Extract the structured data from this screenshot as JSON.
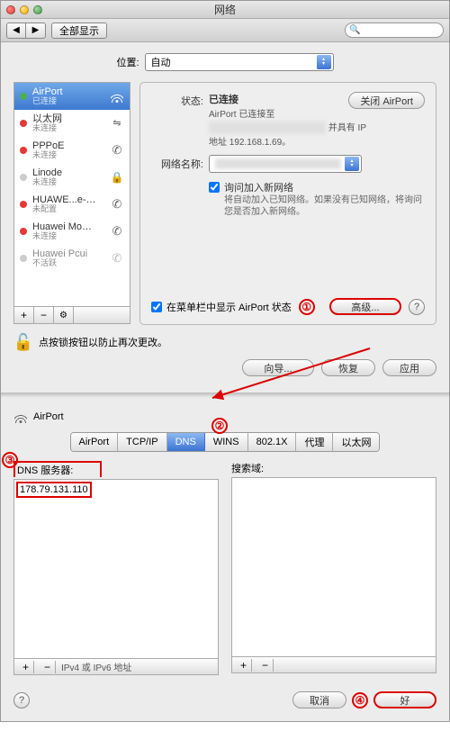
{
  "window": {
    "title": "网络"
  },
  "toolbar": {
    "showall": "全部显示"
  },
  "location": {
    "label": "位置:",
    "value": "自动"
  },
  "sidebar": {
    "items": [
      {
        "name": "AirPort",
        "status": "已连接",
        "dot": "green",
        "icon": "wifi"
      },
      {
        "name": "以太网",
        "status": "未连接",
        "dot": "red",
        "icon": "ethernet"
      },
      {
        "name": "PPPoE",
        "status": "未连接",
        "dot": "red",
        "icon": "phone"
      },
      {
        "name": "Linode",
        "status": "未连接",
        "dot": "none",
        "icon": "lock"
      },
      {
        "name": "HUAWE...e-MMS",
        "status": "未配置",
        "dot": "red",
        "icon": "phone"
      },
      {
        "name": "Huawei Modem",
        "status": "未连接",
        "dot": "red",
        "icon": "phone"
      },
      {
        "name": "Huawei Pcui",
        "status": "不活跃",
        "dot": "none",
        "icon": "phone"
      }
    ]
  },
  "pane": {
    "status_k": "状态:",
    "status_v": "已连接",
    "close_airport": "关闭 AirPort",
    "status_detail1": "AirPort 已连接至",
    "status_detail2": "并具有 IP",
    "status_detail3": "地址 192.168.1.69。",
    "netname_k": "网络名称:",
    "ask_join": "询问加入新网络",
    "ask_hint": "将自动加入已知网络。如果没有已知网络，将询问您是否加入新网络。",
    "showmenu": "在菜单栏中显示 AirPort 状态",
    "advanced": "高级..."
  },
  "lockrow": {
    "text": "点按锁按钮以防止再次更改。"
  },
  "actions": {
    "wizard": "向导...",
    "revert": "恢复",
    "apply": "应用"
  },
  "panel2": {
    "title": "AirPort",
    "tabs": [
      "AirPort",
      "TCP/IP",
      "DNS",
      "WINS",
      "802.1X",
      "代理",
      "以太网"
    ],
    "active_tab": "DNS",
    "dns_label": "DNS 服务器:",
    "search_label": "搜索域:",
    "dns_entry": "178.79.131.110",
    "ipv_note": "IPv4 或 IPv6 地址",
    "cancel": "取消",
    "ok": "好"
  },
  "ann": {
    "a1": "①",
    "a2": "②",
    "a3": "③",
    "a4": "④"
  }
}
